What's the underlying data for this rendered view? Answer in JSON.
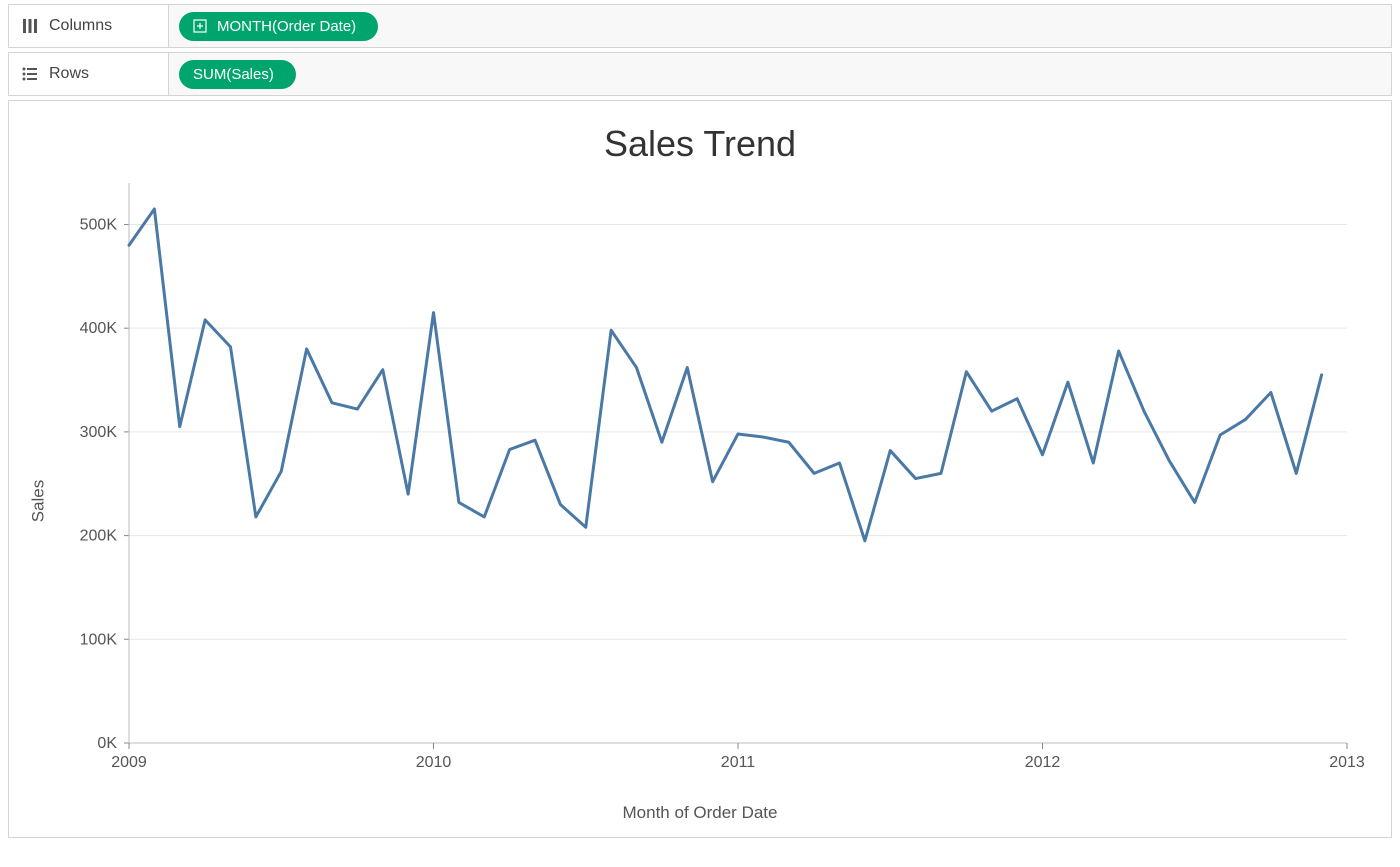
{
  "shelves": {
    "columns": {
      "label": "Columns",
      "pill": "MONTH(Order Date)"
    },
    "rows": {
      "label": "Rows",
      "pill": "SUM(Sales)"
    }
  },
  "chart_data": {
    "type": "line",
    "title": "Sales Trend",
    "xlabel": "Month of Order Date",
    "ylabel": "Sales",
    "ylim": [
      0,
      540000
    ],
    "y_ticks": [
      0,
      100000,
      200000,
      300000,
      400000,
      500000
    ],
    "y_tick_labels": [
      "0K",
      "100K",
      "200K",
      "300K",
      "400K",
      "500K"
    ],
    "x_tick_year_indices": [
      0,
      12,
      24,
      36,
      48
    ],
    "x_tick_year_labels": [
      "2009",
      "2010",
      "2011",
      "2012",
      "2013"
    ],
    "series": [
      {
        "name": "Sales",
        "color": "#4A79A6",
        "values": [
          480000,
          515000,
          305000,
          408000,
          382000,
          218000,
          262000,
          380000,
          328000,
          322000,
          360000,
          240000,
          415000,
          232000,
          218000,
          283000,
          292000,
          230000,
          208000,
          398000,
          362000,
          290000,
          362000,
          252000,
          298000,
          295000,
          290000,
          260000,
          270000,
          195000,
          282000,
          255000,
          260000,
          358000,
          320000,
          332000,
          278000,
          348000,
          270000,
          378000,
          320000,
          272000,
          232000,
          297000,
          312000,
          338000,
          260000,
          355000
        ]
      }
    ],
    "categories_count": 48
  }
}
